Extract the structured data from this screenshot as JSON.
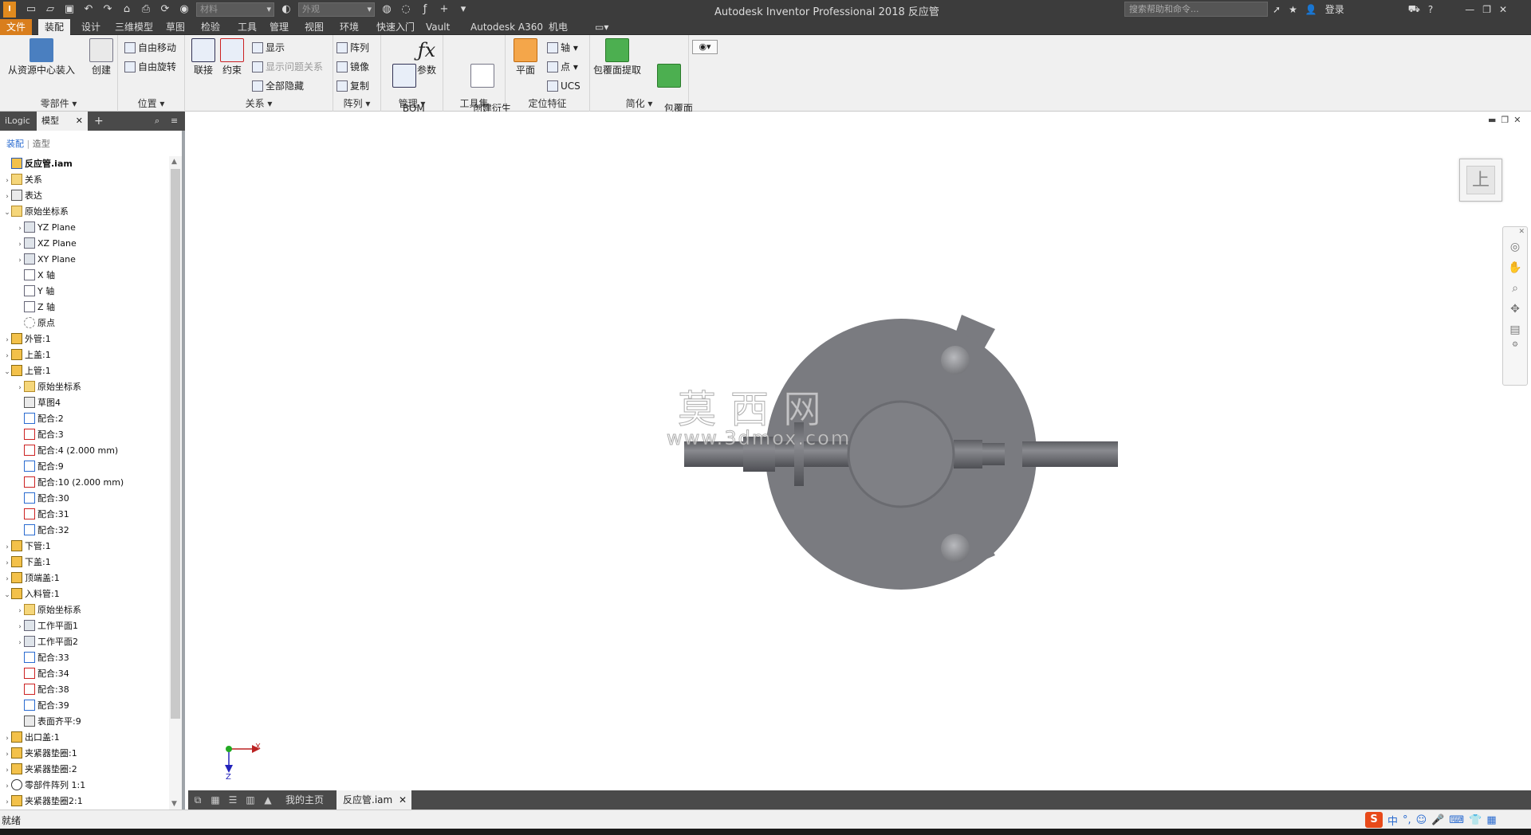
{
  "titlebar": {
    "app_logo": "I",
    "window_title": "Autodesk Inventor Professional 2018   反应管",
    "material_combo": "材料",
    "appearance_combo": "外观",
    "search_placeholder": "搜索帮助和命令...",
    "login": "登录",
    "help": "?",
    "minimize": "—",
    "restore": "❐",
    "close": "✕"
  },
  "menu": {
    "tabs": [
      "文件",
      "装配",
      "设计",
      "三维模型",
      "草图",
      "检验",
      "工具",
      "管理",
      "视图",
      "环境",
      "快速入门",
      "Vault",
      "Autodesk A360",
      "机电"
    ],
    "active_index": 1
  },
  "ribbon": {
    "panels": {
      "component": {
        "label": "零部件 ▾",
        "place_from_cc": "从资源中心装入",
        "create": "创建"
      },
      "position": {
        "label": "位置 ▾",
        "free_move": "自由移动",
        "free_rotate": "自由旋转"
      },
      "relationships": {
        "label": "关系 ▾",
        "joint": "联接",
        "constrain": "约束",
        "show": "显示",
        "show_sick": "显示问题关系",
        "hide_all": "全部隐藏"
      },
      "pattern": {
        "label": "阵列 ▾",
        "pattern": "阵列",
        "mirror": "镜像",
        "copy": "复制"
      },
      "manage": {
        "label": "管理 ▾",
        "bom": "BOM\n表",
        "params": "参数"
      },
      "productivity": {
        "label": "工具集",
        "derive": "创建衍生\n替换"
      },
      "work_features": {
        "label": "定位特征",
        "plane": "平面",
        "axis": "轴 ▾",
        "point": "点 ▾",
        "ucs": "UCS"
      },
      "simplification": {
        "label": "简化 ▾",
        "shrinkwrap": "包覆面提取",
        "shrinkwrap_sub": "包覆面\n提取替换"
      }
    }
  },
  "browser": {
    "tabs": [
      "iLogic",
      "模型",
      "+"
    ],
    "subtabs": [
      "装配",
      "造型"
    ],
    "tree": [
      {
        "level": 0,
        "tw": "",
        "icon": "asm",
        "label": "反应管.iam"
      },
      {
        "level": 0,
        "tw": "›",
        "icon": "folder",
        "label": "关系"
      },
      {
        "level": 0,
        "tw": "›",
        "icon": "sketch",
        "label": "表达"
      },
      {
        "level": 0,
        "tw": "⌄",
        "icon": "folder",
        "label": "原始坐标系"
      },
      {
        "level": 1,
        "tw": "›",
        "icon": "plane",
        "label": "YZ Plane"
      },
      {
        "level": 1,
        "tw": "›",
        "icon": "plane",
        "label": "XZ Plane"
      },
      {
        "level": 1,
        "tw": "›",
        "icon": "plane",
        "label": "XY Plane"
      },
      {
        "level": 1,
        "tw": "",
        "icon": "axis",
        "label": "X 轴"
      },
      {
        "level": 1,
        "tw": "",
        "icon": "axis",
        "label": "Y 轴"
      },
      {
        "level": 1,
        "tw": "",
        "icon": "axis",
        "label": "Z 轴"
      },
      {
        "level": 1,
        "tw": "",
        "icon": "origin",
        "label": "原点"
      },
      {
        "level": 0,
        "tw": "›",
        "icon": "part",
        "label": "外管:1"
      },
      {
        "level": 0,
        "tw": "›",
        "icon": "part",
        "label": "上盖:1"
      },
      {
        "level": 0,
        "tw": "⌄",
        "icon": "part",
        "label": "上管:1"
      },
      {
        "level": 1,
        "tw": "›",
        "icon": "folder",
        "label": "原始坐标系"
      },
      {
        "level": 1,
        "tw": "",
        "icon": "sketch",
        "label": "草图4"
      },
      {
        "level": 1,
        "tw": "",
        "icon": "con",
        "label": "配合:2"
      },
      {
        "level": 1,
        "tw": "",
        "icon": "con2",
        "label": "配合:3"
      },
      {
        "level": 1,
        "tw": "",
        "icon": "con2",
        "label": "配合:4 (2.000 mm)"
      },
      {
        "level": 1,
        "tw": "",
        "icon": "con",
        "label": "配合:9"
      },
      {
        "level": 1,
        "tw": "",
        "icon": "con2",
        "label": "配合:10 (2.000 mm)"
      },
      {
        "level": 1,
        "tw": "",
        "icon": "con",
        "label": "配合:30"
      },
      {
        "level": 1,
        "tw": "",
        "icon": "con2",
        "label": "配合:31"
      },
      {
        "level": 1,
        "tw": "",
        "icon": "con",
        "label": "配合:32"
      },
      {
        "level": 0,
        "tw": "›",
        "icon": "part",
        "label": "下管:1"
      },
      {
        "level": 0,
        "tw": "›",
        "icon": "part",
        "label": "下盖:1"
      },
      {
        "level": 0,
        "tw": "›",
        "icon": "part",
        "label": "顶端盖:1"
      },
      {
        "level": 0,
        "tw": "⌄",
        "icon": "part",
        "label": "入料管:1"
      },
      {
        "level": 1,
        "tw": "›",
        "icon": "folder",
        "label": "原始坐标系"
      },
      {
        "level": 1,
        "tw": "›",
        "icon": "plane",
        "label": "工作平面1"
      },
      {
        "level": 1,
        "tw": "›",
        "icon": "plane",
        "label": "工作平面2"
      },
      {
        "level": 1,
        "tw": "",
        "icon": "con",
        "label": "配合:33"
      },
      {
        "level": 1,
        "tw": "",
        "icon": "con2",
        "label": "配合:34"
      },
      {
        "level": 1,
        "tw": "",
        "icon": "con2",
        "label": "配合:38"
      },
      {
        "level": 1,
        "tw": "",
        "icon": "con",
        "label": "配合:39"
      },
      {
        "level": 1,
        "tw": "",
        "icon": "sketch",
        "label": "表面齐平:9"
      },
      {
        "level": 0,
        "tw": "›",
        "icon": "part",
        "label": "出口盖:1"
      },
      {
        "level": 0,
        "tw": "›",
        "icon": "part",
        "label": "夹紧器垫圈:1"
      },
      {
        "level": 0,
        "tw": "›",
        "icon": "part",
        "label": "夹紧器垫圈:2"
      },
      {
        "level": 0,
        "tw": "›",
        "icon": "pat",
        "label": "零部件阵列 1:1"
      },
      {
        "level": 0,
        "tw": "›",
        "icon": "part",
        "label": "夹紧器垫圈2:1"
      }
    ]
  },
  "viewport": {
    "viewcube_face": "上",
    "axis_x": "X",
    "axis_z": "Z",
    "watermark_cn": "莫西网",
    "watermark_url": "www.3dmox.com",
    "model_color": "#7a7b80"
  },
  "doctabs": {
    "home": "我的主页",
    "active_doc": "反应管.iam",
    "close": "✕"
  },
  "status": {
    "text": "就绪",
    "ime_s": "S",
    "ime_lang": "中"
  }
}
